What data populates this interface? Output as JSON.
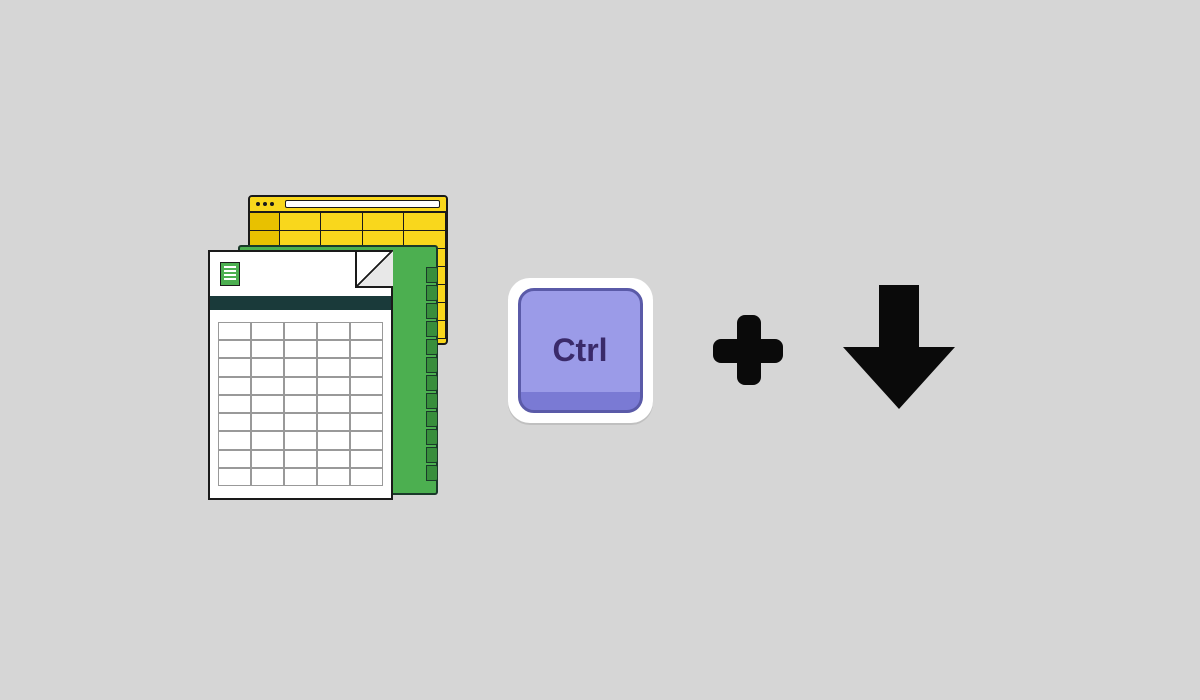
{
  "shortcut": {
    "key_label": "Ctrl",
    "operator": "plus",
    "direction": "down"
  },
  "icons": {
    "spreadsheet": "spreadsheet-stack-icon",
    "key": "ctrl-key-icon",
    "plus": "plus-icon",
    "arrow": "arrow-down-icon"
  }
}
